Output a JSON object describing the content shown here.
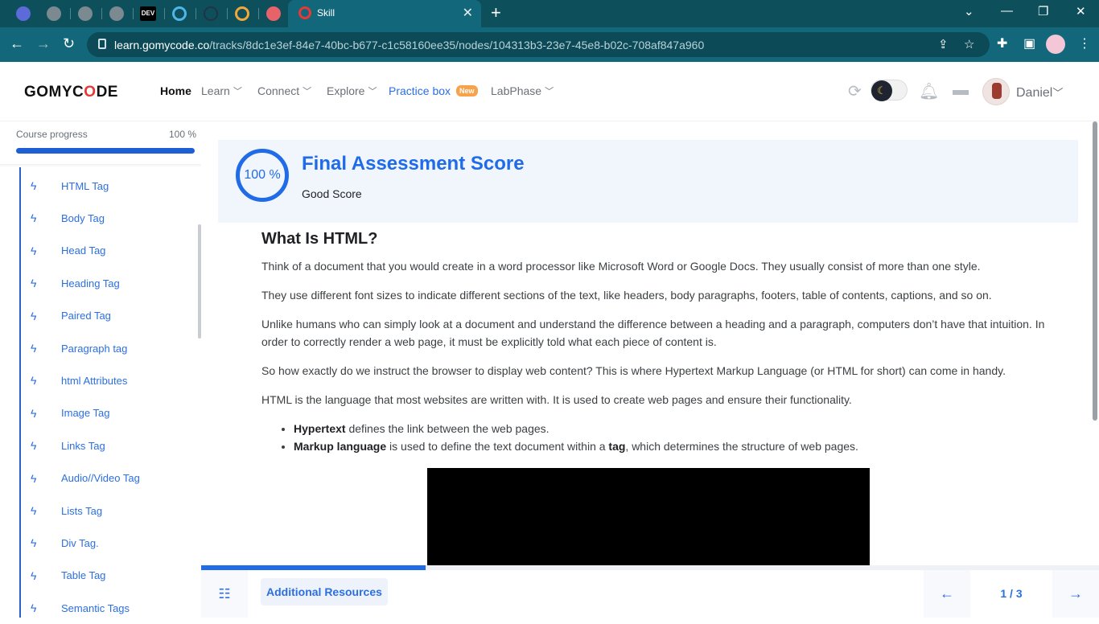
{
  "browser": {
    "active_tab_title": "Skill",
    "url_host": "learn.gomycode.co",
    "url_path": "/tracks/8dc1e3ef-84e7-40bc-b677-c1c58160ee35/nodes/104313b3-23e7-45e8-b02c-708af847a960",
    "other_tab_dev_label": "DEV"
  },
  "header": {
    "logo": "GOMYCODE",
    "nav": [
      {
        "label": "Home"
      },
      {
        "label": "Learn"
      },
      {
        "label": "Connect"
      },
      {
        "label": "Explore"
      },
      {
        "label": "Practice box",
        "badge": "New"
      },
      {
        "label": "LabPhase"
      }
    ],
    "user_name": "Daniel"
  },
  "sidebar": {
    "progress_label": "Course progress",
    "progress_value": "100 %",
    "progress_fraction": 1.0,
    "lessons": [
      "HTML Tag",
      "Body Tag",
      "Head Tag",
      "Heading Tag",
      "Paired Tag",
      "Paragraph tag",
      "html Attributes",
      "Image Tag",
      "Links Tag",
      "Audio//Video Tag",
      "Lists Tag",
      "Div Tag.",
      "Table Tag",
      "Semantic Tags"
    ]
  },
  "score": {
    "value": "100 %",
    "title": "Final Assessment Score",
    "subtitle": "Good Score"
  },
  "article": {
    "heading": "What Is HTML?",
    "p1": "Think of a document that you would create in a word processor like Microsoft Word or Google Docs. They usually consist of more than one style.",
    "p2": "They use different font sizes to indicate different sections of the text, like headers, body paragraphs, footers, table of contents, captions, and so on.",
    "p3": "Unlike humans who can simply look at a document and understand the difference between a heading and a paragraph, computers don’t have that intuition. In order to correctly render a web page, it must be explicitly told what each piece of content is.",
    "p4": "So how exactly do we instruct the browser to display web content? This is where Hypertext Markup Language (or HTML for short) can come in handy.",
    "p5": "HTML is the language that most websites are written with. It is used to create web pages and ensure their functionality.",
    "li1_term": "Hypertext",
    "li1_text": " defines the link between the web pages.",
    "li2_term": "Markup language",
    "li2_text_a": " is used to define the text document within a ",
    "li2_term2": "tag",
    "li2_text_b": ", which determines the structure of web pages."
  },
  "footer": {
    "resources_label": "Additional Resources",
    "page_indicator": "1 / 3",
    "slide_progress_fraction": 0.25
  }
}
